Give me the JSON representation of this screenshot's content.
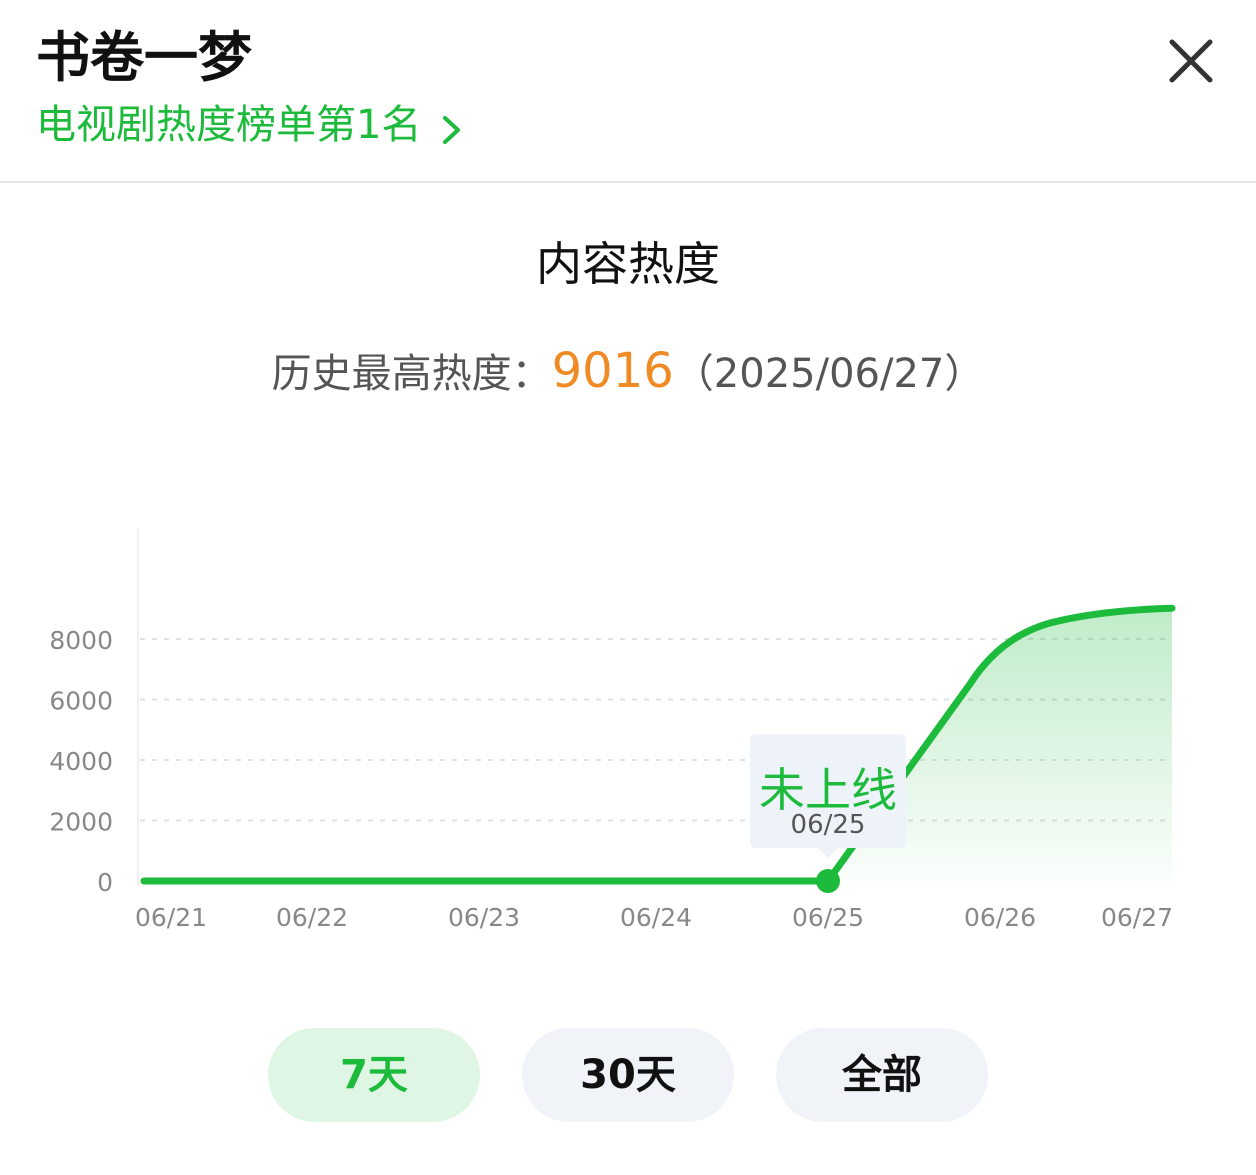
{
  "header": {
    "title": "书卷一梦",
    "rank_text": "电视剧热度榜单第1名"
  },
  "section_title": "内容热度",
  "history": {
    "label": "历史最高热度：",
    "value": "9016",
    "date": "（2025/06/27）"
  },
  "tooltip": {
    "status": "未上线",
    "date": "06/25"
  },
  "range_buttons": [
    {
      "label": "7天",
      "active": true
    },
    {
      "label": "30天",
      "active": false
    },
    {
      "label": "全部",
      "active": false
    }
  ],
  "colors": {
    "accent": "#1dbb3c",
    "highlight": "#f08a24",
    "axis_text": "#888888"
  },
  "chart_data": {
    "type": "area",
    "x": [
      "06/21",
      "06/22",
      "06/23",
      "06/24",
      "06/25",
      "06/26",
      "06/27"
    ],
    "values": [
      0,
      0,
      0,
      0,
      0,
      8000,
      9016
    ],
    "yticks": [
      0,
      2000,
      4000,
      6000,
      8000
    ],
    "ylim": [
      0,
      11500
    ],
    "grid": true,
    "highlight_point": {
      "x": "06/25",
      "value": 0
    }
  }
}
